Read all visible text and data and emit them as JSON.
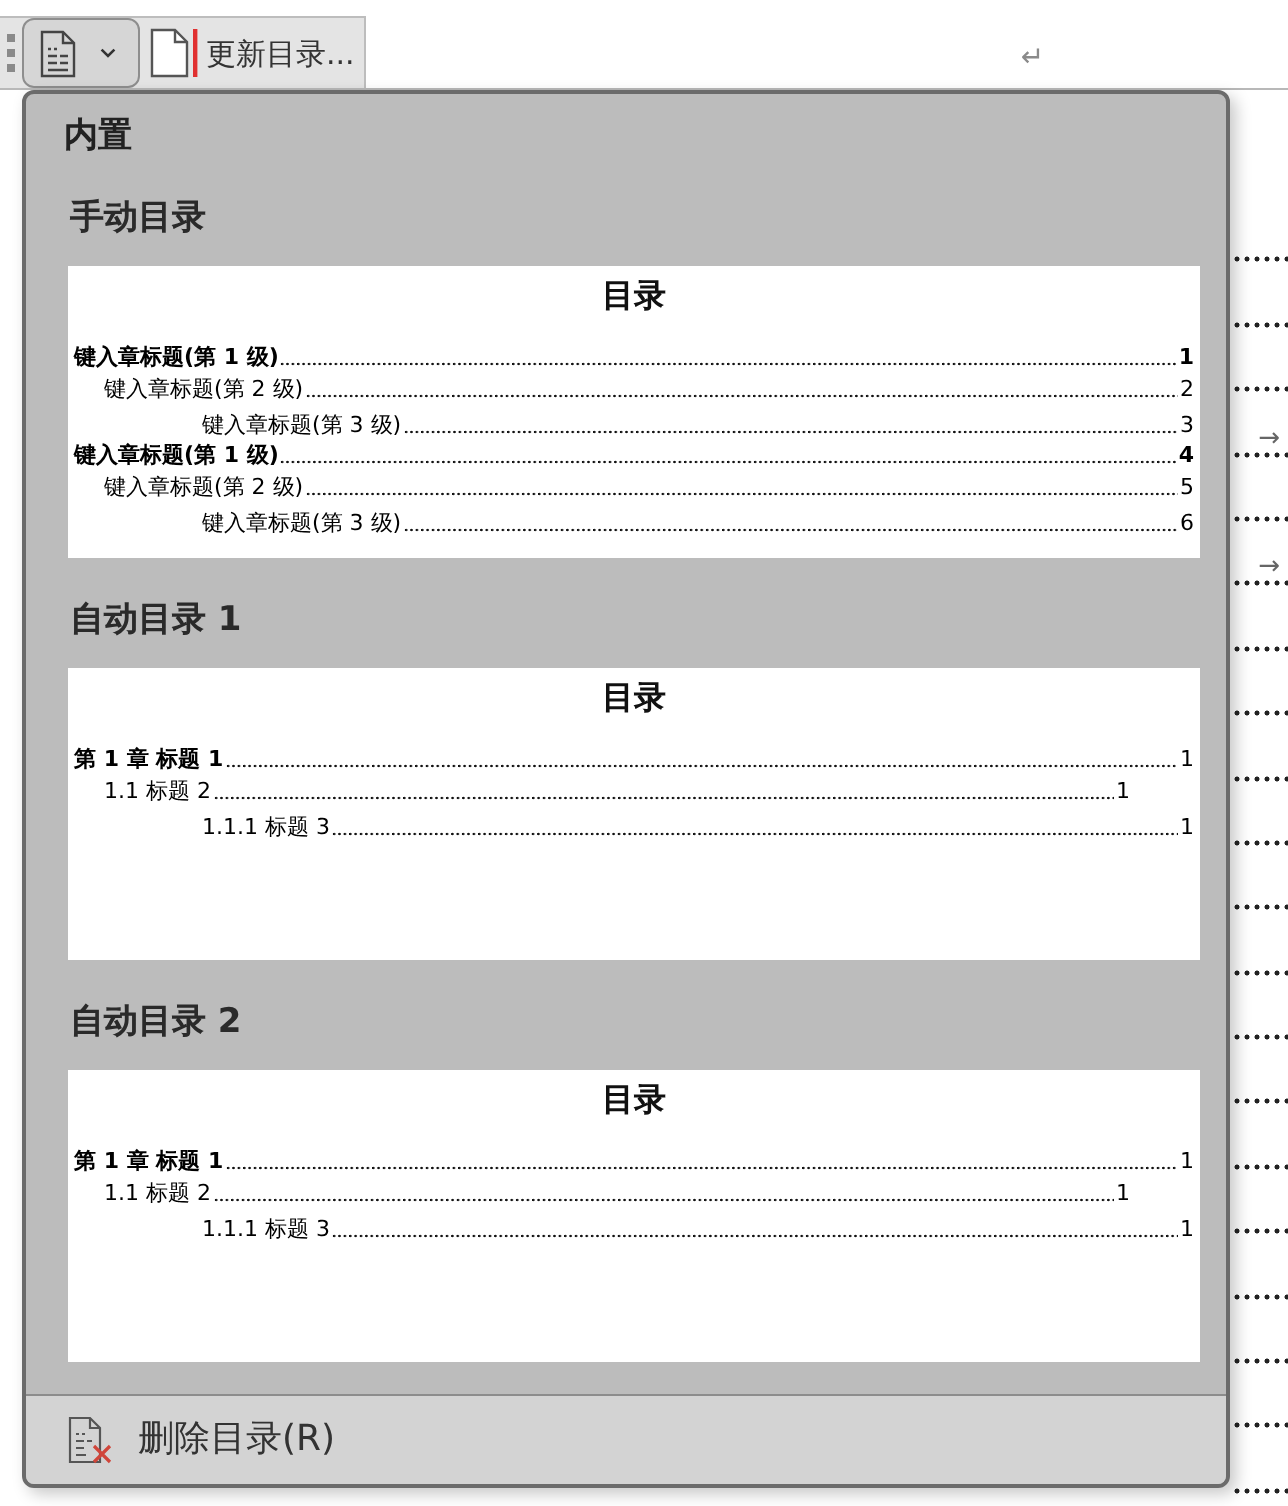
{
  "toolbar": {
    "toc_button": {
      "expanded": true
    },
    "update_button": {
      "label": "更新目录..."
    }
  },
  "document": {
    "return_mark": "↵",
    "lines": [
      {
        "kind": "leader"
      },
      {
        "kind": "leader"
      },
      {
        "kind": "leader"
      },
      {
        "kind": "tab",
        "tab_mark": "→"
      },
      {
        "kind": "leader"
      },
      {
        "kind": "tab",
        "tab_mark": "→"
      },
      {
        "kind": "leader"
      },
      {
        "kind": "leader"
      },
      {
        "kind": "leader"
      },
      {
        "kind": "leader"
      },
      {
        "kind": "leader"
      },
      {
        "kind": "leader"
      },
      {
        "kind": "leader"
      },
      {
        "kind": "leader"
      },
      {
        "kind": "leader"
      },
      {
        "kind": "leader"
      },
      {
        "kind": "leader"
      },
      {
        "kind": "leader"
      },
      {
        "kind": "leader"
      },
      {
        "kind": "leader"
      }
    ]
  },
  "toc_menu": {
    "category": "内置",
    "galleries": [
      {
        "title": "手动目录",
        "kind": "manual",
        "preview": {
          "heading": "目录",
          "entries": [
            {
              "text": "键入章标题(第 1 级)",
              "page": "1",
              "children": [
                {
                  "text": "键入章标题(第 2 级)",
                  "page": "2",
                  "children": [
                    {
                      "text": "键入章标题(第 3 级)",
                      "page": "3"
                    }
                  ]
                }
              ]
            },
            {
              "text": "键入章标题(第 1 级)",
              "page": "4",
              "children": [
                {
                  "text": "键入章标题(第 2 级)",
                  "page": "5",
                  "children": [
                    {
                      "text": "键入章标题(第 3 级)",
                      "page": "6"
                    }
                  ]
                }
              ]
            }
          ]
        }
      },
      {
        "title": "自动目录 1",
        "kind": "auto",
        "preview": {
          "heading": "目录",
          "entries": [
            {
              "text": "第 1 章 标题 1",
              "page": "1",
              "children": [
                {
                  "text": "1.1 标题 2",
                  "page": "1",
                  "children": [
                    {
                      "text": "1.1.1 标题 3",
                      "page": "1"
                    }
                  ]
                }
              ]
            }
          ]
        }
      },
      {
        "title": "自动目录 2",
        "kind": "auto",
        "preview": {
          "heading": "目录",
          "entries": [
            {
              "text": "第 1 章 标题 1",
              "page": "1",
              "children": [
                {
                  "text": "1.1 标题 2",
                  "page": "1",
                  "children": [
                    {
                      "text": "1.1.1 标题 3",
                      "page": "1"
                    }
                  ]
                }
              ]
            }
          ]
        }
      }
    ],
    "footer": {
      "label": "删除目录(R)"
    }
  }
}
